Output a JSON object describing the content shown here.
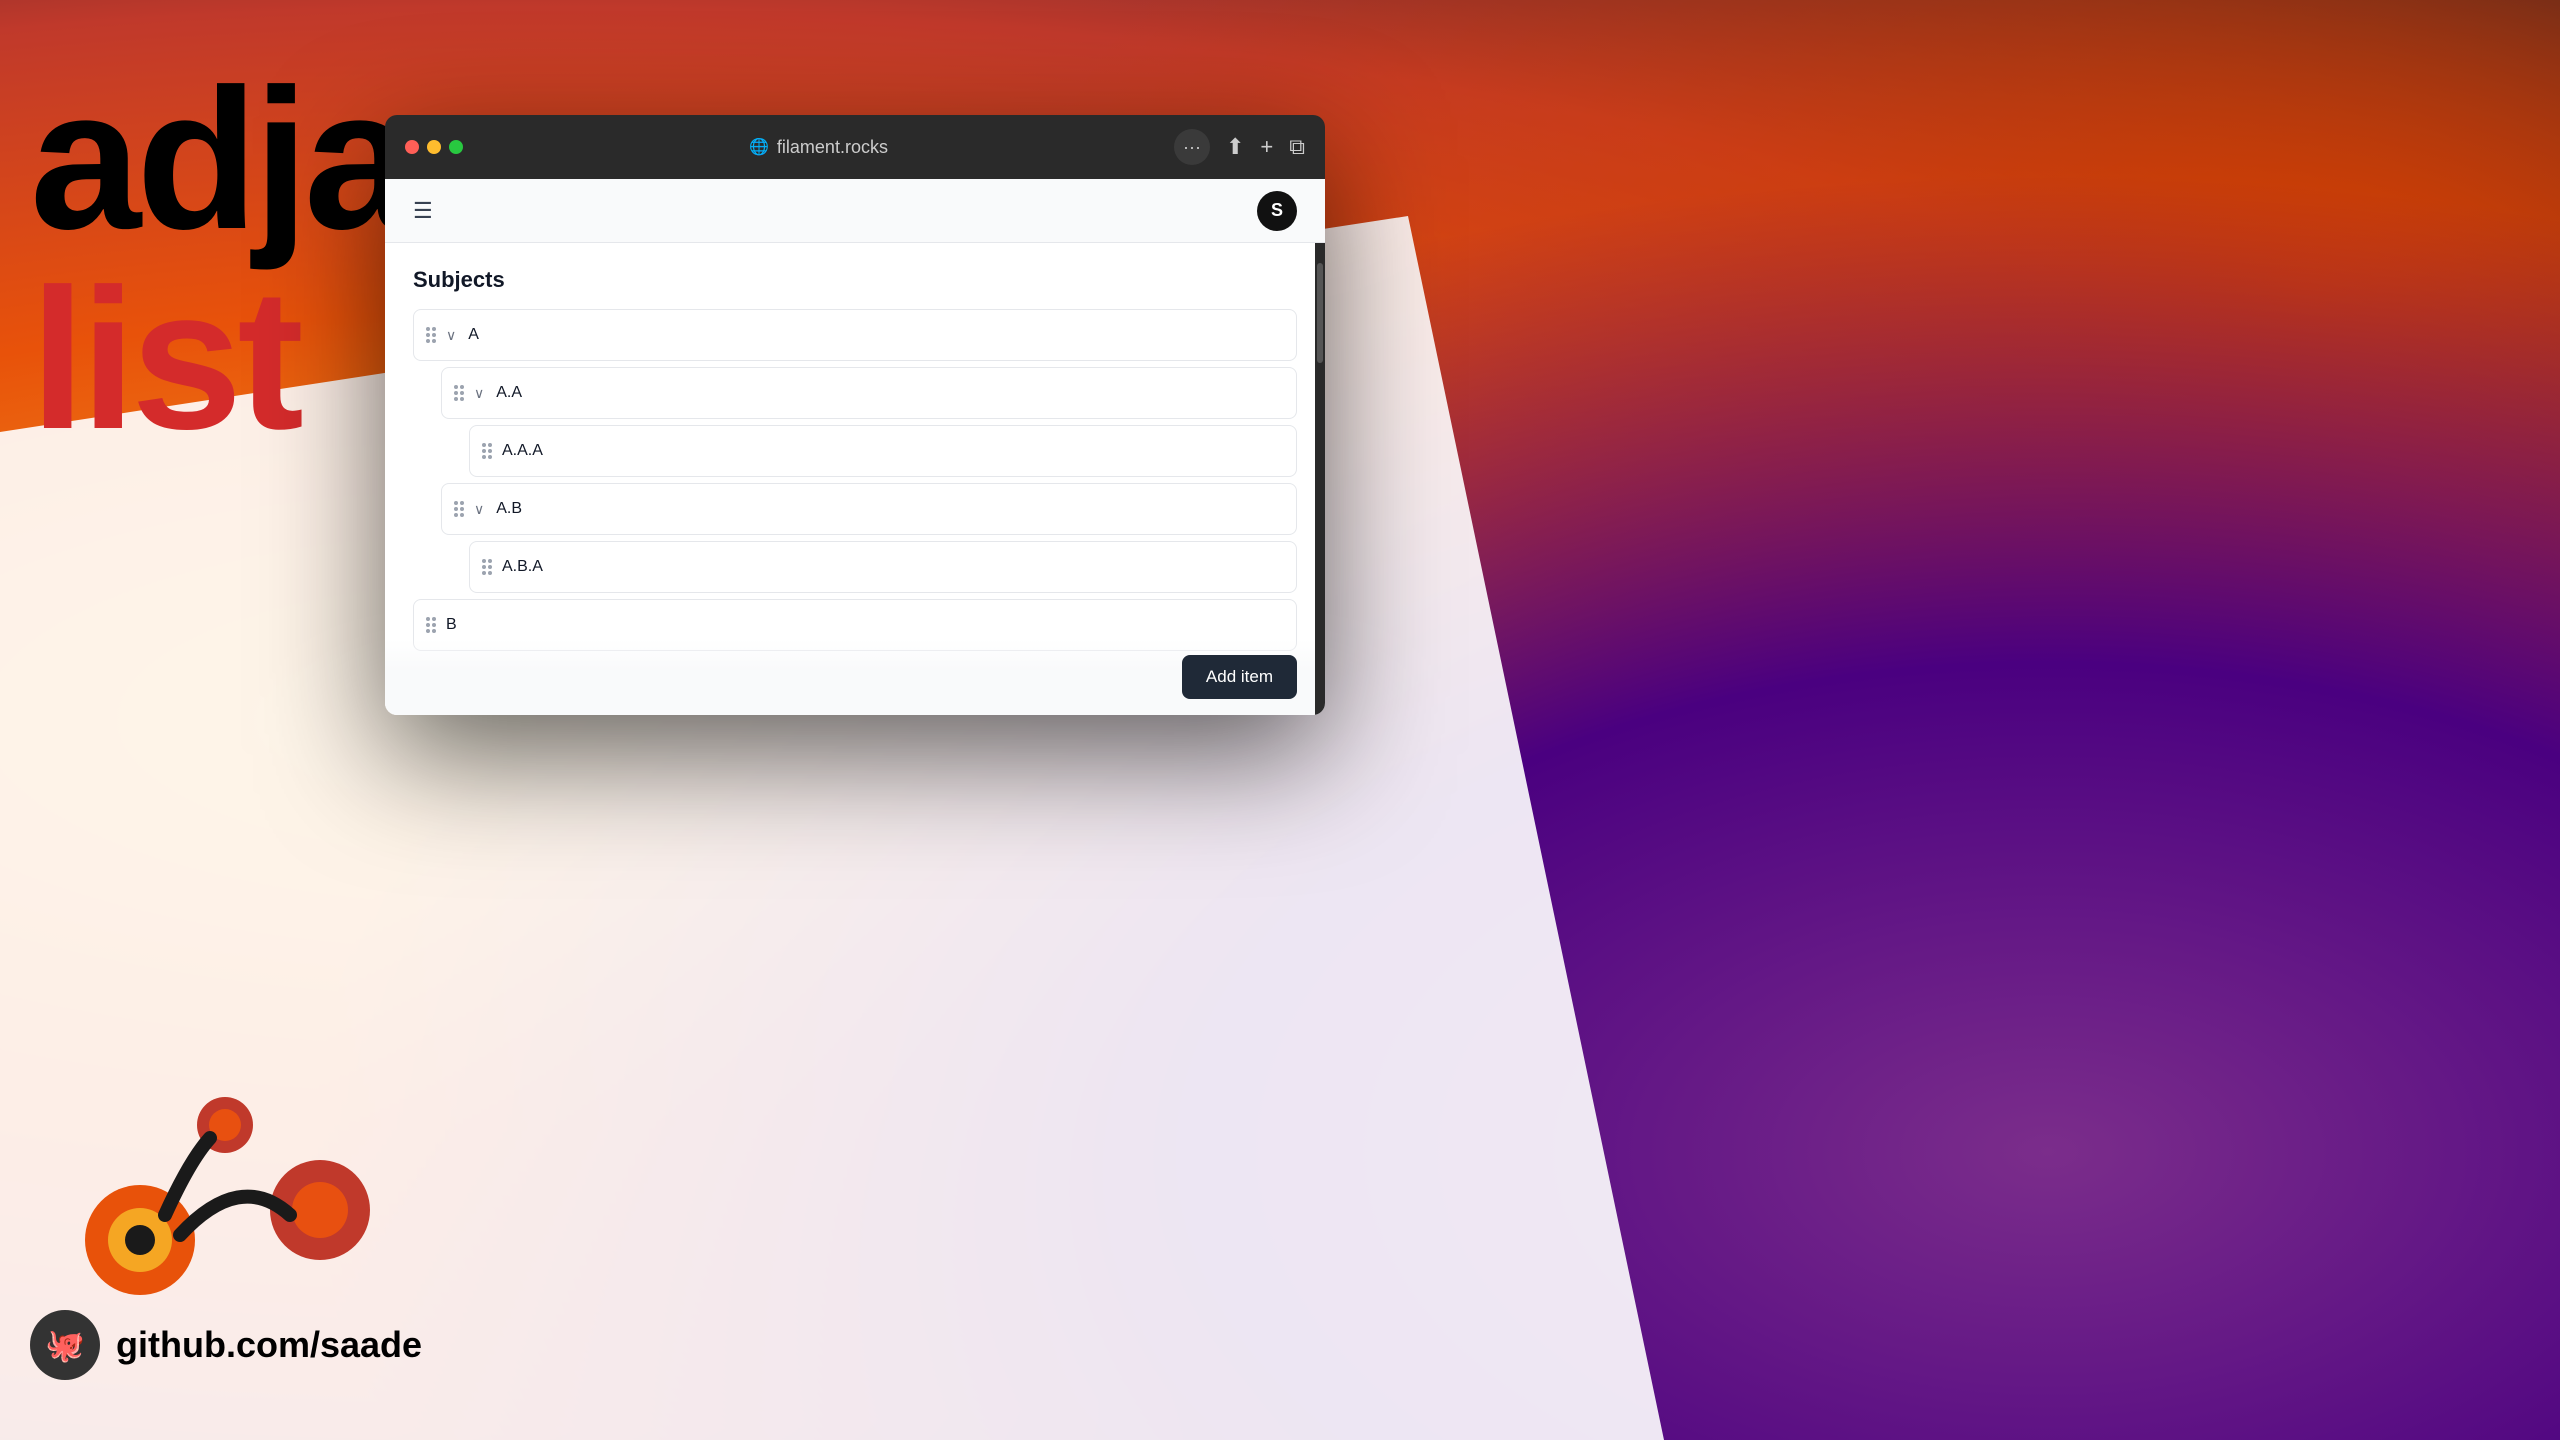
{
  "background": {
    "colors": {
      "primary_gradient_start": "#f5a623",
      "primary_gradient_mid": "#e8520a",
      "accent_purple": "#7b2d8b",
      "dark": "#1a1a2e"
    }
  },
  "hero": {
    "line1": "adjacency",
    "line2": "list"
  },
  "github": {
    "url": "github.com/saade"
  },
  "browser": {
    "url": "filament.rocks",
    "more_button_label": "···",
    "share_icon": "↑□",
    "new_tab_icon": "+",
    "copy_icon": "⧉",
    "user_avatar_label": "S"
  },
  "navbar": {
    "menu_icon": "☰"
  },
  "page": {
    "title": "Subjects"
  },
  "list_items": [
    {
      "id": "item-a",
      "label": "A",
      "indent": 0,
      "has_children": true,
      "expanded": true
    },
    {
      "id": "item-aa",
      "label": "A.A",
      "indent": 1,
      "has_children": true,
      "expanded": true
    },
    {
      "id": "item-aaa",
      "label": "A.A.A",
      "indent": 2,
      "has_children": false,
      "expanded": false
    },
    {
      "id": "item-ab",
      "label": "A.B",
      "indent": 1,
      "has_children": true,
      "expanded": true
    },
    {
      "id": "item-aba",
      "label": "A.B.A",
      "indent": 2,
      "has_children": false,
      "expanded": false
    },
    {
      "id": "item-b",
      "label": "B",
      "indent": 0,
      "has_children": false,
      "expanded": false
    }
  ],
  "footer": {
    "add_button_label": "Add item"
  }
}
